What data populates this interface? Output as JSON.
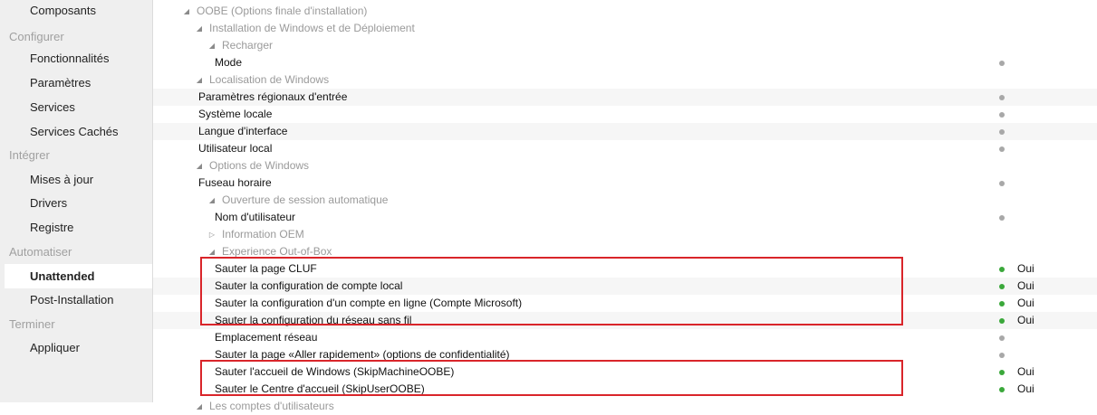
{
  "sidebar": {
    "items": [
      {
        "label": "Composants",
        "type": "item"
      },
      {
        "label": "Configurer",
        "type": "section"
      },
      {
        "label": "Fonctionnalités",
        "type": "item"
      },
      {
        "label": "Paramètres",
        "type": "item"
      },
      {
        "label": "Services",
        "type": "item"
      },
      {
        "label": "Services Cachés",
        "type": "item"
      },
      {
        "label": "Intégrer",
        "type": "section"
      },
      {
        "label": "Mises à jour",
        "type": "item"
      },
      {
        "label": "Drivers",
        "type": "item"
      },
      {
        "label": "Registre",
        "type": "item"
      },
      {
        "label": "Automatiser",
        "type": "section"
      },
      {
        "label": "Unattended",
        "type": "item",
        "active": true
      },
      {
        "label": "Post-Installation",
        "type": "item"
      },
      {
        "label": "Terminer",
        "type": "section"
      },
      {
        "label": "Appliquer",
        "type": "item"
      }
    ]
  },
  "tree": {
    "rows": [
      {
        "label": "OOBE (Options finale d'installation)",
        "kind": "category",
        "level": 0,
        "expander": "expanded"
      },
      {
        "label": "Installation de Windows et de Déploiement",
        "kind": "category",
        "level": 1,
        "expander": "expanded"
      },
      {
        "label": "Recharger",
        "kind": "category",
        "level": 2,
        "expander": "expanded"
      },
      {
        "label": "Mode",
        "kind": "setting",
        "level": 3,
        "dot": "gray",
        "value": ""
      },
      {
        "label": "Localisation de Windows",
        "kind": "category",
        "level": 1,
        "expander": "expanded"
      },
      {
        "label": "Paramètres régionaux d'entrée",
        "kind": "setting",
        "level": 2,
        "dot": "gray",
        "value": ""
      },
      {
        "label": "Système locale",
        "kind": "setting",
        "level": 2,
        "dot": "gray",
        "value": ""
      },
      {
        "label": "Langue d'interface",
        "kind": "setting",
        "level": 2,
        "dot": "gray",
        "value": ""
      },
      {
        "label": "Utilisateur local",
        "kind": "setting",
        "level": 2,
        "dot": "gray",
        "value": ""
      },
      {
        "label": "Options de Windows",
        "kind": "category",
        "level": 1,
        "expander": "expanded"
      },
      {
        "label": "Fuseau horaire",
        "kind": "setting",
        "level": 2,
        "dot": "gray",
        "value": ""
      },
      {
        "label": "Ouverture de session automatique",
        "kind": "category",
        "level": 2,
        "expander": "expanded"
      },
      {
        "label": "Nom d'utilisateur",
        "kind": "setting",
        "level": 3,
        "dot": "gray",
        "value": ""
      },
      {
        "label": "Information OEM",
        "kind": "category-collapsed",
        "level": 2,
        "expander": "collapsed"
      },
      {
        "label": "Experience Out-of-Box",
        "kind": "category",
        "level": 2,
        "expander": "expanded"
      },
      {
        "label": "Sauter la page CLUF",
        "kind": "setting",
        "level": 3,
        "dot": "green",
        "value": "Oui"
      },
      {
        "label": "Sauter la configuration de compte local",
        "kind": "setting",
        "level": 3,
        "dot": "green",
        "value": "Oui"
      },
      {
        "label": "Sauter la configuration d'un compte en ligne (Compte Microsoft)",
        "kind": "setting",
        "level": 3,
        "dot": "green",
        "value": "Oui"
      },
      {
        "label": "Sauter la configuration du réseau sans fil",
        "kind": "setting",
        "level": 3,
        "dot": "green",
        "value": "Oui"
      },
      {
        "label": "Emplacement réseau",
        "kind": "setting",
        "level": 3,
        "dot": "gray",
        "value": ""
      },
      {
        "label": "Sauter la page «Aller rapidement» (options de confidentialité)",
        "kind": "setting",
        "level": 3,
        "dot": "gray",
        "value": ""
      },
      {
        "label": "Sauter l'accueil de Windows (SkipMachineOOBE)",
        "kind": "setting",
        "level": 3,
        "dot": "green",
        "value": "Oui"
      },
      {
        "label": "Sauter le Centre d'accueil (SkipUserOOBE)",
        "kind": "setting",
        "level": 3,
        "dot": "green",
        "value": "Oui"
      },
      {
        "label": "Les comptes d'utilisateurs",
        "kind": "category",
        "level": 1,
        "expander": "expanded"
      }
    ]
  },
  "highlight_color": "#d9252a",
  "status_colors": {
    "enabled": "#3aa83a",
    "unset": "#a8a8a8"
  },
  "icons": {
    "expanded": "expanded-triangle-icon",
    "collapsed": "collapsed-triangle-icon"
  }
}
